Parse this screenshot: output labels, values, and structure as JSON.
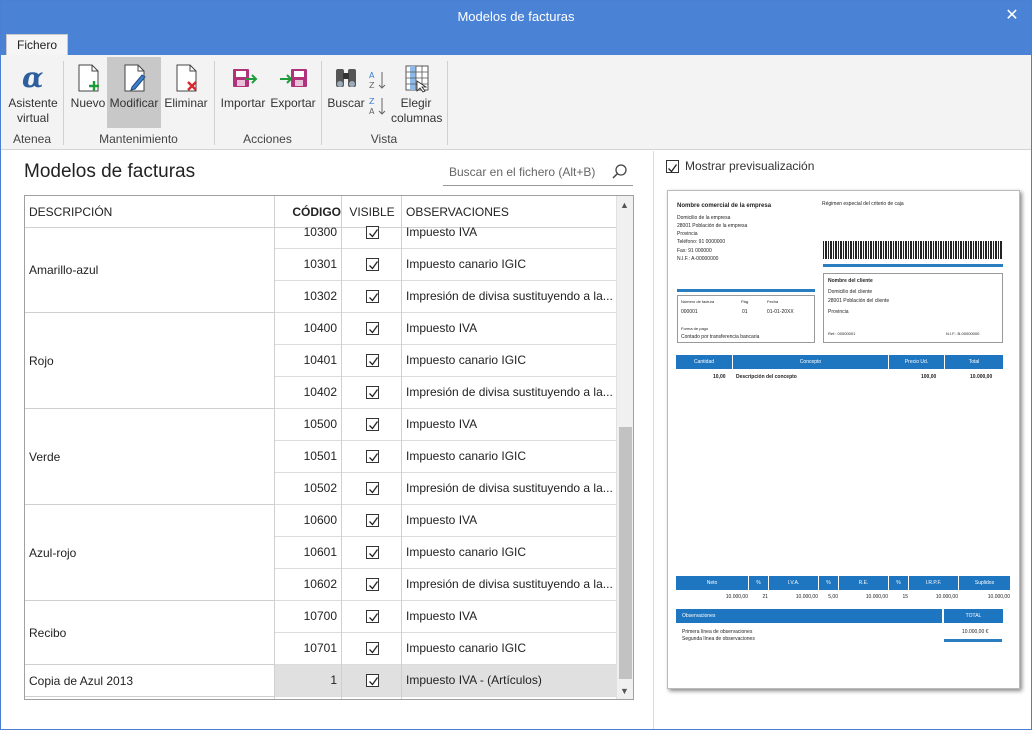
{
  "window": {
    "title": "Modelos de facturas",
    "close_glyph": "✕"
  },
  "tabs": [
    {
      "label": "Fichero"
    }
  ],
  "ribbon": {
    "buttons": {
      "asistente": "Asistente\nvirtual",
      "nuevo": "Nuevo",
      "modificar": "Modificar",
      "eliminar": "Eliminar",
      "importar": "Importar",
      "exportar": "Exportar",
      "buscar": "Buscar",
      "elegir": "Elegir\ncolumnas"
    },
    "groups": {
      "atenea": "Atenea",
      "mantenimiento": "Mantenimiento",
      "acciones": "Acciones",
      "vista": "Vista"
    }
  },
  "page_title": "Modelos de facturas",
  "search": {
    "placeholder": "Buscar en el fichero (Alt+B)"
  },
  "table": {
    "headers": {
      "descripcion": "DESCRIPCIÓN",
      "codigo": "CÓDIGO",
      "visible": "VISIBLE",
      "observaciones": "OBSERVACIONES"
    },
    "groups": [
      {
        "name": "Amarillo-azul"
      },
      {
        "name": "Rojo"
      },
      {
        "name": "Verde"
      },
      {
        "name": "Azul-rojo"
      },
      {
        "name": "Recibo"
      },
      {
        "name": "Copia de Azul 2013"
      }
    ],
    "rows": [
      {
        "codigo": "10300",
        "obs": "Impuesto IVA"
      },
      {
        "codigo": "10301",
        "obs": "Impuesto canario IGIC"
      },
      {
        "codigo": "10302",
        "obs": "Impresión de divisa sustituyendo a la..."
      },
      {
        "codigo": "10400",
        "obs": "Impuesto IVA"
      },
      {
        "codigo": "10401",
        "obs": "Impuesto canario IGIC"
      },
      {
        "codigo": "10402",
        "obs": "Impresión de divisa sustituyendo a la..."
      },
      {
        "codigo": "10500",
        "obs": "Impuesto IVA"
      },
      {
        "codigo": "10501",
        "obs": "Impuesto canario IGIC"
      },
      {
        "codigo": "10502",
        "obs": "Impresión de divisa sustituyendo a la..."
      },
      {
        "codigo": "10600",
        "obs": "Impuesto IVA"
      },
      {
        "codigo": "10601",
        "obs": "Impuesto canario IGIC"
      },
      {
        "codigo": "10602",
        "obs": "Impresión de divisa sustituyendo a la..."
      },
      {
        "codigo": "10700",
        "obs": "Impuesto IVA"
      },
      {
        "codigo": "10701",
        "obs": "Impuesto canario IGIC"
      },
      {
        "codigo": "1",
        "obs": "Impuesto IVA - (Artículos)"
      }
    ]
  },
  "preview": {
    "toggle_label": "Mostrar previsualización",
    "empresa": "Nombre comercial de la empresa",
    "regimen": "Régimen especial del criterio de caja",
    "dom_empresa": "Domicilio de la empresa",
    "pob_empresa": "28001    Población de la empresa",
    "provincia": "Provincia",
    "telefono": "Teléfono:  91 0000000",
    "fax": "Fax:   91 000000",
    "nif": "N.I.F.: A-00000000",
    "cliente": "Nombre del cliente",
    "dom_cliente": "Domicilio del cliente",
    "pob_cliente": "28001 Población del cliente",
    "prov_cliente": "Provincia",
    "ref": "Ref.:    00000001",
    "nif_cliente": "N.I.F.:   B-00000000",
    "num_label": "Número de factura",
    "pag_label": "Pág.",
    "fecha_label": "Fecha",
    "num_val": "000001",
    "pag_val": "01",
    "fecha_val": "01-01-20XX",
    "forma_label": "Forma de pago",
    "forma_val": "Contado por transferencia bancaria",
    "lines_hdr": {
      "cantidad": "Cantidad",
      "concepto": "Concepto",
      "precio": "Precio Ud.",
      "total": "Total"
    },
    "line": {
      "cantidad": "10,00",
      "concepto": "Descripción del concepto",
      "precio": "100,00",
      "total": "10.000,00"
    },
    "tot_hdr": {
      "neto": "Neto",
      "p1": "%",
      "iva": "I.V.A.",
      "p2": "%",
      "re": "R.E.",
      "p3": "%",
      "irpf": "I.R.P.F.",
      "suplidos": "Suplidos"
    },
    "tot_val": {
      "neto": "10.000,00",
      "p1": "21",
      "iva": "10.000,00",
      "p2": "5,00",
      "re": "10.000,00",
      "p3": "15",
      "irpf": "10.000,00",
      "suplidos": "10.000,00"
    },
    "obs_label": "Observaciones",
    "total_label": "TOTAL",
    "obs1": "Primera línea de observaciones",
    "obs2": "Segunda línea de observaciones",
    "total_val": "10.000,00  €"
  },
  "colors": {
    "accent": "#4a82d6",
    "preview_blue": "#1f76c0"
  }
}
